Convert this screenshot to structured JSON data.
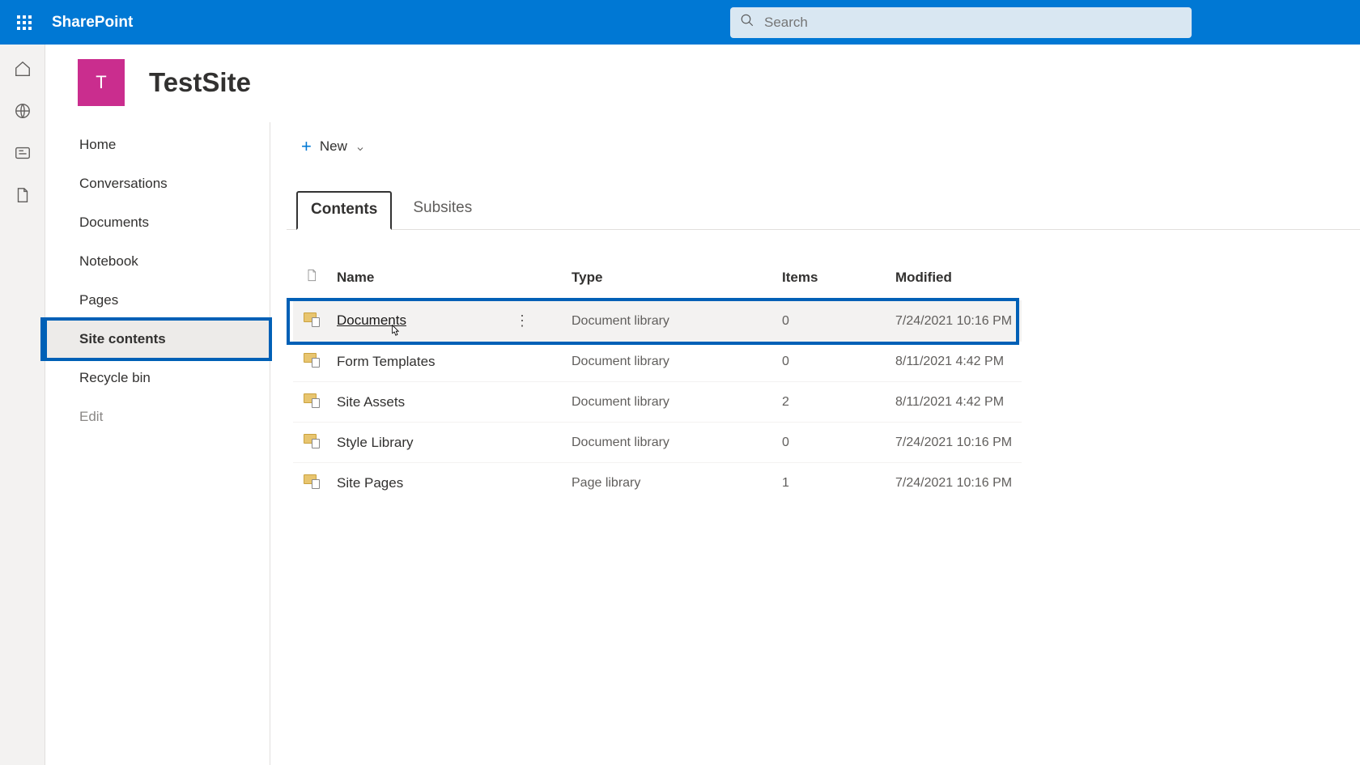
{
  "brand": "SharePoint",
  "search": {
    "placeholder": "Search"
  },
  "site": {
    "avatar_letter": "T",
    "title": "TestSite"
  },
  "sidebar": {
    "items": [
      {
        "label": "Home"
      },
      {
        "label": "Conversations"
      },
      {
        "label": "Documents"
      },
      {
        "label": "Notebook"
      },
      {
        "label": "Pages"
      },
      {
        "label": "Site contents"
      },
      {
        "label": "Recycle bin"
      },
      {
        "label": "Edit"
      }
    ]
  },
  "commands": {
    "new_label": "New"
  },
  "tabs": [
    {
      "label": "Contents"
    },
    {
      "label": "Subsites"
    }
  ],
  "columns": {
    "name": "Name",
    "type": "Type",
    "items": "Items",
    "modified": "Modified"
  },
  "rows": [
    {
      "name": "Documents",
      "type": "Document library",
      "items": "0",
      "modified": "7/24/2021 10:16 PM"
    },
    {
      "name": "Form Templates",
      "type": "Document library",
      "items": "0",
      "modified": "8/11/2021 4:42 PM"
    },
    {
      "name": "Site Assets",
      "type": "Document library",
      "items": "2",
      "modified": "8/11/2021 4:42 PM"
    },
    {
      "name": "Style Library",
      "type": "Document library",
      "items": "0",
      "modified": "7/24/2021 10:16 PM"
    },
    {
      "name": "Site Pages",
      "type": "Page library",
      "items": "1",
      "modified": "7/24/2021 10:16 PM"
    }
  ]
}
